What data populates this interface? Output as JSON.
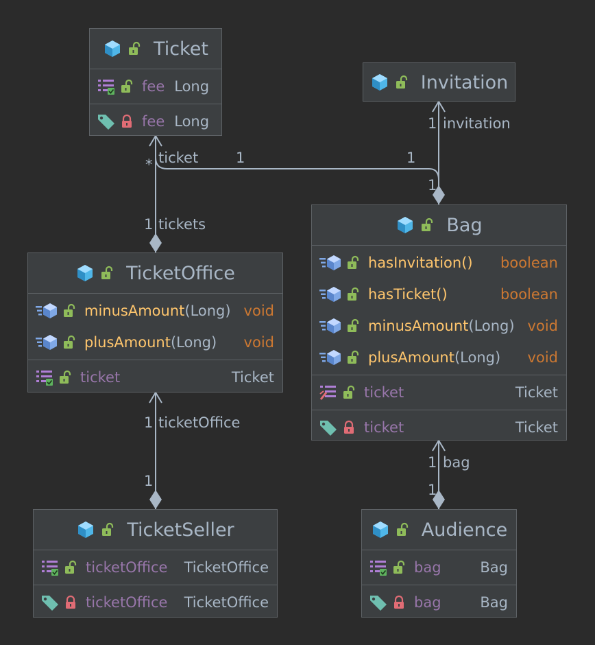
{
  "classes": {
    "ticket": {
      "name": "Ticket",
      "fields": [
        {
          "name": "fee",
          "type": "Long"
        }
      ],
      "properties": [
        {
          "name": "fee",
          "type": "Long"
        }
      ]
    },
    "invitation": {
      "name": "Invitation"
    },
    "ticket_office": {
      "name": "TicketOffice",
      "methods": [
        {
          "name": "minusAmount",
          "params": "(Long)",
          "type": "void"
        },
        {
          "name": "plusAmount",
          "params": "(Long)",
          "type": "void"
        }
      ],
      "fields": [
        {
          "name": "ticket",
          "type": "Ticket"
        }
      ]
    },
    "bag": {
      "name": "Bag",
      "methods": [
        {
          "name": "hasInvitation",
          "params": "()",
          "type": "boolean"
        },
        {
          "name": "hasTicket",
          "params": "()",
          "type": "boolean"
        },
        {
          "name": "minusAmount",
          "params": "(Long)",
          "type": "void"
        },
        {
          "name": "plusAmount",
          "params": "(Long)",
          "type": "void"
        }
      ],
      "fields": [
        {
          "name": "ticket",
          "type": "Ticket"
        }
      ],
      "properties": [
        {
          "name": "ticket",
          "type": "Ticket"
        }
      ]
    },
    "ticket_seller": {
      "name": "TicketSeller",
      "fields": [
        {
          "name": "ticketOffice",
          "type": "TicketOffice"
        }
      ],
      "properties": [
        {
          "name": "ticketOffice",
          "type": "TicketOffice"
        }
      ]
    },
    "audience": {
      "name": "Audience",
      "fields": [
        {
          "name": "bag",
          "type": "Bag"
        }
      ],
      "properties": [
        {
          "name": "bag",
          "type": "Bag"
        }
      ]
    }
  },
  "relations": {
    "office_tickets": {
      "target_mult": "*",
      "target_role": "ticket",
      "source_mult": "1",
      "source_role": "tickets"
    },
    "bag_ticket": {
      "source_mult": "1",
      "target_mult": "1",
      "source_end": "1"
    },
    "bag_invitation": {
      "target_mult": "1",
      "target_role": "invitation"
    },
    "seller_office": {
      "target_mult": "1",
      "target_role": "ticketOffice",
      "source_mult": "1"
    },
    "audience_bag": {
      "target_mult": "1",
      "target_role": "bag",
      "source_mult": "1"
    }
  },
  "colors": {
    "background": "#2b2b2b",
    "box": "#3c3f41",
    "field_name": "#9876aa",
    "method_name": "#ffc66d",
    "type_keyword": "#cc7832",
    "text": "#a9b7c6",
    "class_icon": "#4fb6e8",
    "lock_open": "#8fbc5a",
    "lock_closed": "#e06c75",
    "tag": "#6fbfb0"
  },
  "icons": {
    "class": "class-icon",
    "public": "unlock-icon",
    "private": "lock-icon",
    "field": "field-list-icon",
    "method": "method-icon",
    "property": "tag-icon"
  }
}
